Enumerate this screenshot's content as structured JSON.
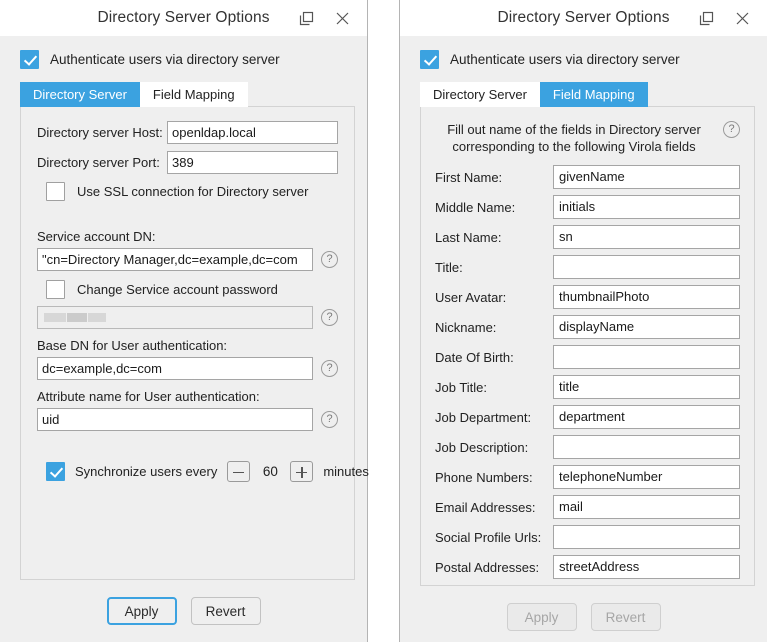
{
  "colors": {
    "accent": "#3ba2e0",
    "window_bg": "#efefef",
    "field_bg": "#ffffff",
    "border": "#a5a5a5"
  },
  "left_window": {
    "title": "Directory Server Options",
    "titlebar": {
      "restore_icon": "restore-window-icon",
      "close_icon": "close-icon"
    },
    "auth_checkbox": {
      "label": "Authenticate users via directory server",
      "checked": true
    },
    "tabs": [
      {
        "label": "Directory Server",
        "active": true
      },
      {
        "label": "Field Mapping",
        "active": false
      }
    ],
    "fields": {
      "host_label": "Directory server Host:",
      "host_value": "openldap.local",
      "port_label": "Directory server Port:",
      "port_value": "389",
      "ssl_label": "Use SSL connection for Directory server",
      "ssl_checked": false,
      "service_dn_label": "Service account DN:",
      "service_dn_value": "\"cn=Directory Manager,dc=example,dc=com",
      "change_pwd_label": "Change Service account password",
      "change_pwd_checked": false,
      "password_value": "",
      "base_dn_label": "Base DN for User authentication:",
      "base_dn_value": "dc=example,dc=com",
      "attr_label": "Attribute name for User authentication:",
      "attr_value": "uid"
    },
    "sync": {
      "label": "Synchronize users every",
      "checked": true,
      "minus": "−",
      "value": "60",
      "plus": "+",
      "unit": "minutes"
    },
    "footer": {
      "apply_label": "Apply",
      "revert_label": "Revert",
      "apply_focused": true,
      "apply_disabled": false,
      "revert_disabled": false
    },
    "help_icon": "?"
  },
  "right_window": {
    "title": "Directory Server Options",
    "titlebar": {
      "restore_icon": "restore-window-icon",
      "close_icon": "close-icon"
    },
    "auth_checkbox": {
      "label": "Authenticate users via directory server",
      "checked": true
    },
    "tabs": [
      {
        "label": "Directory Server",
        "active": false
      },
      {
        "label": "Field Mapping",
        "active": true
      }
    ],
    "hint_line1": "Fill out name of the fields in Directory server",
    "hint_line2": "corresponding to the following Virola fields",
    "mappings": [
      {
        "label": "First Name:",
        "value": "givenName"
      },
      {
        "label": "Middle Name:",
        "value": "initials"
      },
      {
        "label": "Last Name:",
        "value": "sn"
      },
      {
        "label": "Title:",
        "value": ""
      },
      {
        "label": "User Avatar:",
        "value": "thumbnailPhoto"
      },
      {
        "label": "Nickname:",
        "value": "displayName"
      },
      {
        "label": "Date Of Birth:",
        "value": ""
      },
      {
        "label": "Job Title:",
        "value": "title"
      },
      {
        "label": "Job Department:",
        "value": "department"
      },
      {
        "label": "Job Description:",
        "value": ""
      },
      {
        "label": "Phone Numbers:",
        "value": "telephoneNumber"
      },
      {
        "label": "Email Addresses:",
        "value": "mail"
      },
      {
        "label": "Social Profile Urls:",
        "value": ""
      },
      {
        "label": "Postal Addresses:",
        "value": "streetAddress"
      }
    ],
    "footer": {
      "apply_label": "Apply",
      "revert_label": "Revert",
      "apply_focused": false,
      "apply_disabled": true,
      "revert_disabled": true
    },
    "help_icon": "?"
  }
}
